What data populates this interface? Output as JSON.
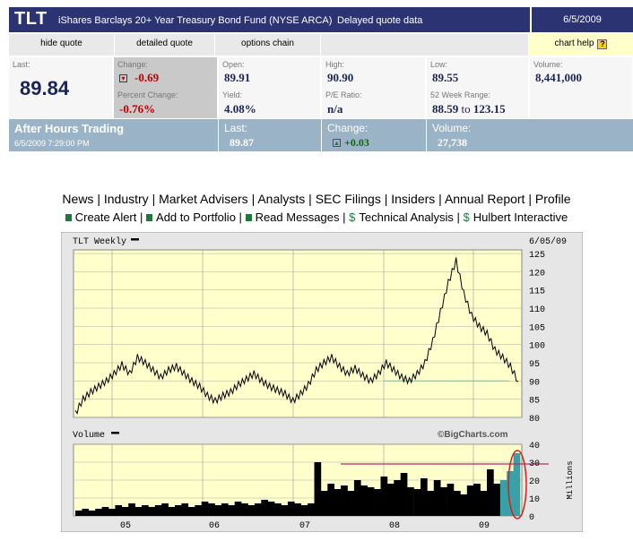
{
  "header": {
    "symbol": "TLT",
    "name": "iShares Barclays 20+ Year Treasury Bond Fund (NYSE ARCA)",
    "delay_note": "Delayed quote data",
    "date": "6/5/2009"
  },
  "nav": {
    "hide_quote": "hide quote",
    "detailed_quote": "detailed quote",
    "options_chain": "options chain",
    "chart_help": "chart help",
    "help_icon_glyph": "?"
  },
  "quote": {
    "last_label": "Last:",
    "last_value": "89.84",
    "change_label": "Change:",
    "change_value": "-0.69",
    "percent_change_label": "Percent Change:",
    "percent_change_value": "-0.76%",
    "open_label": "Open:",
    "open_value": "89.91",
    "yield_label": "Yield:",
    "yield_value": "4.08%",
    "high_label": "High:",
    "high_value": "90.90",
    "pe_label": "P/E Ratio:",
    "pe_value": "n/a",
    "low_label": "Low:",
    "low_value": "89.55",
    "range_label": "52 Week Range:",
    "range_low": "88.59",
    "range_to": "to",
    "range_high": "123.15",
    "volume_label": "Volume:",
    "volume_value": "8,441,000"
  },
  "after_hours": {
    "title": "After Hours Trading",
    "timestamp": "6/5/2009 7:29:00 PM",
    "last_label": "Last:",
    "last_value": "89.87",
    "change_label": "Change:",
    "change_value": "+0.03",
    "volume_label": "Volume:",
    "volume_value": "27,738"
  },
  "links_row1": [
    "News",
    "Industry",
    "Market Advisers",
    "Analysts",
    "SEC Filings",
    "Insiders",
    "Annual Report",
    "Profile"
  ],
  "links_row2": [
    "Create Alert",
    "Add to Portfolio",
    "Read Messages",
    "Technical Analysis",
    "Hulbert Interactive"
  ],
  "link_separator": "|",
  "colors": {
    "header_bg": "#2b3372",
    "after_hours_bg": "#9bb3c6",
    "chart_plot_bg": "#ffffcc",
    "negative": "#c00000",
    "positive": "#116611",
    "support_line": "#5fd0e0",
    "volume_line": "#b0306a",
    "highlight_ellipse": "#d02020"
  },
  "chart_data": [
    {
      "type": "line",
      "title": "TLT Weekly",
      "date_label": "6/05/09",
      "x_tick_labels": [
        "05",
        "06",
        "07",
        "08",
        "09"
      ],
      "y_tick_labels": [
        "80",
        "85",
        "90",
        "95",
        "100",
        "105",
        "110",
        "115",
        "120",
        "125"
      ],
      "ylim": [
        80,
        126
      ],
      "grid": true,
      "support_level": 90,
      "series": [
        {
          "values": [
            81,
            85,
            87,
            88.5,
            90,
            92,
            94.5,
            92,
            96.5,
            95,
            93,
            91,
            93,
            94,
            92,
            90,
            88.5,
            86,
            84.5,
            86,
            87,
            89,
            90.5,
            92,
            90,
            88.5,
            87.5,
            86.5,
            84.5,
            86.5,
            89,
            93,
            95,
            96.5,
            94,
            92,
            93.5,
            91.5,
            90,
            92,
            95,
            93,
            91,
            90,
            92,
            95,
            101,
            109,
            117,
            123,
            114,
            108,
            105,
            103,
            98.5,
            96.5,
            94,
            89.84
          ]
        }
      ]
    },
    {
      "type": "area",
      "title": "Volume",
      "watermark": "©BigCharts.com",
      "ylabel": "Millions",
      "y_tick_labels": [
        "0",
        "10",
        "20",
        "30",
        "40"
      ],
      "ylim": [
        0,
        40
      ],
      "threshold_level": 29,
      "series": [
        {
          "values": [
            3,
            4,
            3,
            4,
            5,
            4,
            6,
            5,
            7,
            5,
            6,
            5,
            6,
            7,
            5,
            6,
            7,
            5,
            6,
            8,
            7,
            6,
            7,
            6,
            8,
            7,
            6,
            7,
            9,
            8,
            7,
            6,
            8,
            7,
            6,
            7,
            30,
            14,
            18,
            15,
            17,
            14,
            20,
            17,
            16,
            15,
            22,
            18,
            20,
            24,
            16,
            15,
            21,
            14,
            20,
            16,
            18,
            14,
            12,
            17,
            18,
            14,
            26,
            18,
            20,
            25,
            35
          ]
        }
      ]
    }
  ]
}
